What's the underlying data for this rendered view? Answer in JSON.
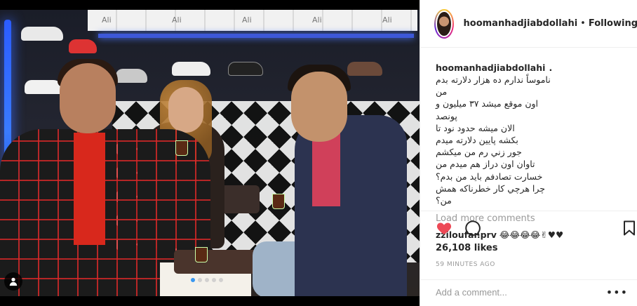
{
  "post": {
    "username": "hoomanhadjiabdollahi",
    "separator": "•",
    "follow_status": "Following",
    "caption_user": "hoomanhadjiabdollahi",
    "caption_user_suffix": ".",
    "caption_lines": [
      "ناموساً ندارم ده هزار دلارته بدم من",
      "اون موقع میشد ۳۷ میلیون و پونصد",
      "الان میشه حدود نود تا",
      "بکشه پایین دلارته میدم",
      "جور زني رم من میکشم",
      "تاوان اون دراز هم میدم من",
      "خسارت تصادفم باید من بدم؟",
      "چرا هرچي كار خطرناكه همش من؟"
    ],
    "load_more": "Load more comments",
    "comment": {
      "user": "zziloufar.prv",
      "text": "😂😂😂😂✌♥♥"
    },
    "likes": "26,108 likes",
    "time_ago": "59 MINUTES AGO",
    "add_comment_placeholder": "Add a comment...",
    "more_label": "•••"
  },
  "media": {
    "carousel_dots": 5,
    "active_dot": 0,
    "store_logo": "Ali"
  },
  "icons": {
    "like": "heart-icon",
    "comment": "comment-bubble-icon",
    "save": "bookmark-icon",
    "tag": "person-tag-icon"
  },
  "colors": {
    "like": "#ed4956",
    "link": "#3897f0",
    "muted": "#999999",
    "text": "#262626"
  }
}
